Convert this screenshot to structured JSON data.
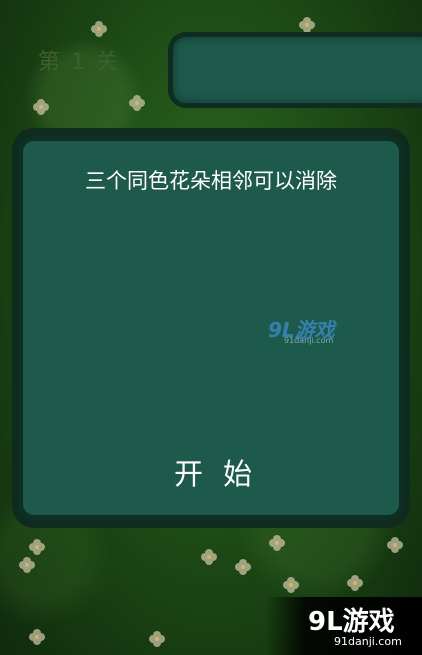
{
  "level": {
    "label": "第 1 关"
  },
  "dialog": {
    "instructions": "三个同色花朵相邻可以消除",
    "start_label": "开 始"
  },
  "watermark_center": {
    "logo": "9L游戏",
    "site": "91danji.com"
  },
  "watermark_corner": {
    "logo": "9L游戏",
    "site": "91danji.com"
  },
  "colors": {
    "panel": "#1d5a4c",
    "panel_border": "#0e2f24",
    "background": "#1f4d17"
  }
}
